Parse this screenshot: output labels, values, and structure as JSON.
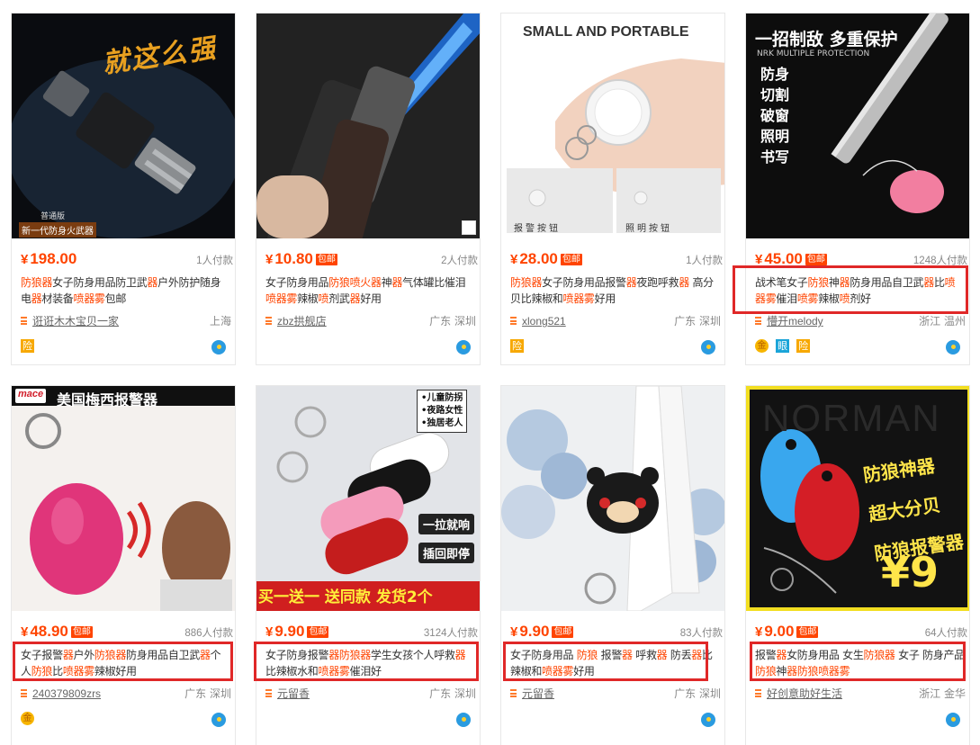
{
  "products": [
    {
      "price": "198.00",
      "baoyou": "",
      "sales": "1人付款",
      "title": [
        "防狼",
        "器",
        "女子防身用品防卫武",
        "器",
        "户外防护随身电",
        "器",
        "材装备",
        "喷器雾",
        "包邮"
      ],
      "shop": "诳诳木木宝贝一家",
      "location": "上海",
      "badges": [
        "险"
      ],
      "thumb_caption_top": "就这么强",
      "thumb_caption_bottom": "新一代防身火武器",
      "thumb_caption_small": "普通版",
      "boxed": false
    },
    {
      "price": "10.80",
      "baoyou": "包邮",
      "sales": "2人付款",
      "title": [
        "女子防身用品",
        "防狼喷火",
        "器",
        "神",
        "器",
        "气体罐比催泪",
        "喷器雾",
        "辣椒",
        "喷",
        "剂武",
        "器",
        "好用"
      ],
      "shop": "zbz拱舰店",
      "location": "广东 深圳",
      "badges": [],
      "boxed": false
    },
    {
      "price": "28.00",
      "baoyou": "包邮",
      "sales": "1人付款",
      "title": [
        "防狼",
        "器",
        "女子防身用品报警",
        "器",
        "夜跑呼救",
        "器",
        " 高分贝比辣椒和",
        "喷器雾",
        "好用"
      ],
      "shop": "xlong521",
      "location": "广东 深圳",
      "badges": [
        "险"
      ],
      "thumb_caption_top": "SMALL AND PORTABLE",
      "thumb_label_left": "报警按钮",
      "thumb_label_right": "照明按钮",
      "boxed": false
    },
    {
      "price": "45.00",
      "baoyou": "包邮",
      "sales": "1248人付款",
      "title": [
        "战术笔女子",
        "防狼",
        "神",
        "器",
        "防身用品自卫武",
        "器",
        "比",
        "喷",
        "器雾",
        "催泪",
        "喷雾",
        "辣椒",
        "喷",
        "剂好"
      ],
      "shop": "懵开melody",
      "location": "浙江 温州",
      "badges": [
        "coin",
        "眼",
        "险"
      ],
      "thumb_caption_top": "一招制敌 多重保护",
      "thumb_caption_sub": "NRK MULTIPLE PROTECTION",
      "thumb_list": [
        "防身",
        "切割",
        "破窗",
        "照明",
        "书写"
      ],
      "boxed": true
    },
    {
      "price": "48.90",
      "baoyou": "包邮",
      "sales": "886人付款",
      "title": [
        "女子报警",
        "器",
        "户外",
        "防狼器",
        "防身用品自卫武",
        "器",
        "个人",
        "防狼",
        "比",
        "喷器雾",
        "辣椒好用"
      ],
      "shop": "240379809zrs",
      "location": "广东 深圳",
      "badges": [
        "coin"
      ],
      "thumb_caption_top": "美国梅西报警器",
      "thumb_brand": "mace",
      "boxed": true
    },
    {
      "price": "9.90",
      "baoyou": "包邮",
      "sales": "3124人付款",
      "title": [
        "女子防身报警",
        "器",
        "防狼器",
        "学生女孩个人呼救",
        "器",
        "比辣椒水和",
        "喷器雾",
        "催泪好"
      ],
      "shop": "元留香",
      "location": "广东 深圳",
      "badges": [],
      "thumb_list": [
        "•儿童防拐",
        "•夜路女性",
        "•独居老人"
      ],
      "thumb_tag1": "一拉就响",
      "thumb_tag2": "插回即停",
      "thumb_caption_bottom": "买一送一 送同款 发货2个",
      "boxed": true
    },
    {
      "price": "9.90",
      "baoyou": "包邮",
      "sales": "83人付款",
      "title": [
        "女子防身用品 ",
        "防狼",
        " 报警",
        "器",
        " 呼救",
        "器",
        " 防丢",
        "器",
        "比辣椒和",
        "喷器雾",
        "好用"
      ],
      "shop": "元留香",
      "location": "广东 深圳",
      "badges": [],
      "boxed": true
    },
    {
      "price": "9.00",
      "baoyou": "包邮",
      "sales": "64人付款",
      "title": [
        "报警",
        "器",
        "女防身用品 女生",
        "防狼器",
        " 女子 防身产品",
        "防狼",
        "神",
        "器",
        "防狼",
        "喷器雾"
      ],
      "shop": "好创意助好生活",
      "location": "浙江 金华",
      "badges": [],
      "thumb_brand": "NORMAN",
      "thumb_list": [
        "防狼神器",
        "超大分贝",
        "防狼报警器"
      ],
      "thumb_price": "¥9",
      "boxed": true
    }
  ],
  "colors": {
    "accent": "#ff4400",
    "highlight_box": "#e02828",
    "text": "#333333",
    "muted": "#888888"
  }
}
